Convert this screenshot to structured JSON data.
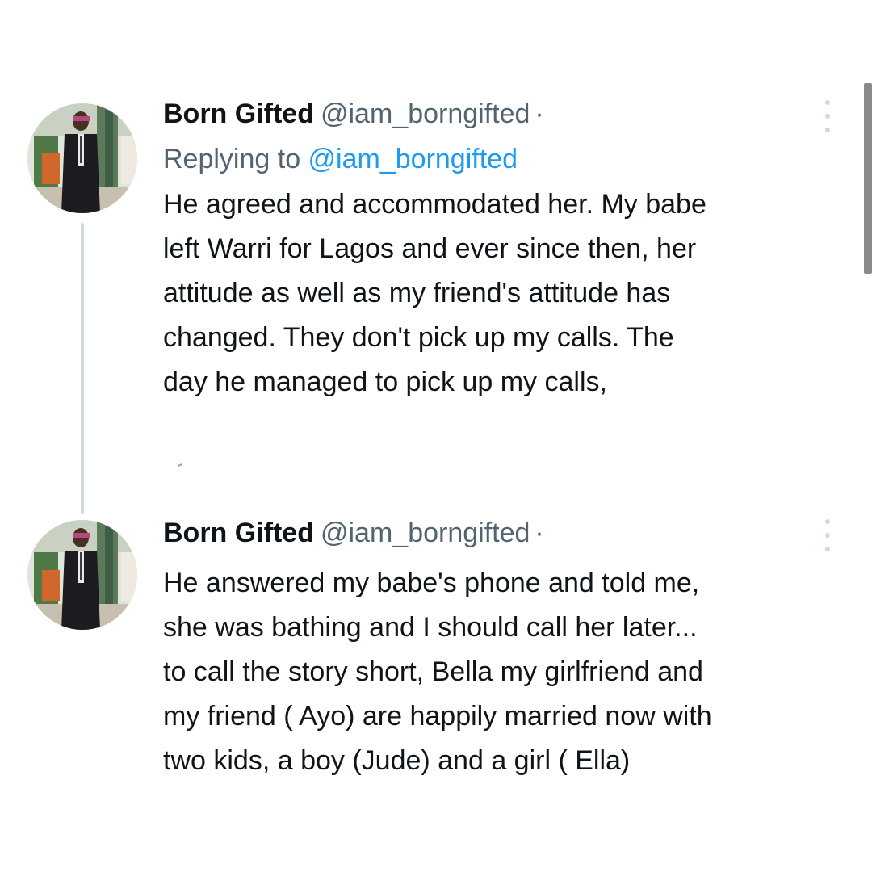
{
  "tweets": [
    {
      "author_name": "Born Gifted",
      "author_handle": "@iam_borngifted",
      "separator": "·",
      "replying_prefix": "Replying to ",
      "replying_handle": "@iam_borngifted",
      "text": "He agreed and accommodated her. My babe\nleft Warri for Lagos and ever since then, her\nattitude as well as my friend's attitude has\nchanged. They don't pick up my calls. The\nday he managed to pick up my calls,"
    },
    {
      "author_name": "Born Gifted",
      "author_handle": "@iam_borngifted",
      "separator": "·",
      "text": "He answered my babe's phone and told me,\nshe was bathing and I should call her later...\nto call the story short, Bella my girlfriend and\nmy friend ( Ayo) are happily married now with\ntwo kids, a boy (Jude) and a girl ( Ella)"
    }
  ],
  "icons": {
    "avatar": "avatar-photo",
    "more": "more-vertical-icon"
  },
  "colors": {
    "link": "#1d9bf0",
    "secondary_text": "#536471",
    "primary_text": "#0f1419",
    "thread_line": "#cfd9de"
  }
}
